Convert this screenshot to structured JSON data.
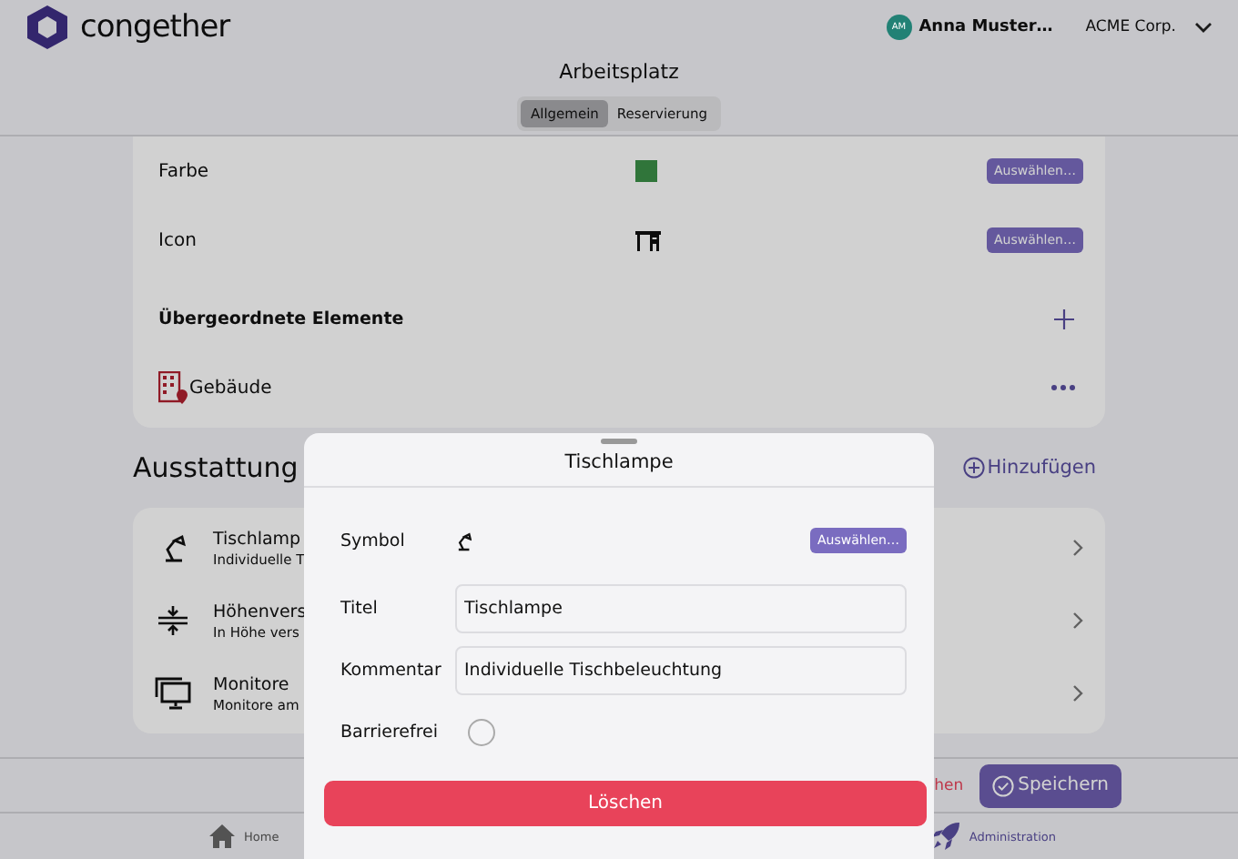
{
  "header": {
    "logo_text": "congether",
    "user": {
      "initials": "AM",
      "name": "Anna Muster…",
      "color": "#228175"
    },
    "organization": "ACME Corp."
  },
  "page": {
    "title": "Arbeitsplatz",
    "tabs": [
      {
        "label": "Allgemein",
        "selected": true
      },
      {
        "label": "Reservierung",
        "selected": false
      }
    ]
  },
  "properties": [
    {
      "kind": "color",
      "label": "Farbe",
      "color": "#30753a",
      "button": "Auswählen…"
    },
    {
      "kind": "icon",
      "label": "Icon",
      "button": "Auswählen…"
    }
  ],
  "parents": {
    "title": "Übergeordnete Elemente",
    "items": [
      {
        "label": "Gebäude"
      }
    ]
  },
  "equipment": {
    "title": "Ausstattung",
    "add_label": "Hinzufügen",
    "items": [
      {
        "kind": "lamp",
        "title": "Tischlamp",
        "subtitle": "Individuelle T"
      },
      {
        "kind": "height",
        "title": "Höhenvers",
        "subtitle": "In Höhe vers"
      },
      {
        "kind": "monitor",
        "title": "Monitore",
        "subtitle": "Monitore am"
      }
    ]
  },
  "footer": {
    "delete_label": "hen",
    "save_label": "Speichern"
  },
  "bottom_nav": [
    {
      "kind": "home",
      "label": "Home"
    },
    {
      "kind": "rocket",
      "label": "Administration"
    }
  ],
  "modal": {
    "title": "Tischlampe",
    "symbol_label": "Symbol",
    "symbol_button": "Auswählen…",
    "fields": [
      {
        "label": "Titel",
        "value": "Tischlampe"
      },
      {
        "label": "Kommentar",
        "value": "Individuelle Tischbeleuchtung"
      }
    ],
    "accessible": {
      "label": "Barrierefrei",
      "checked": false
    },
    "delete_button": "Löschen"
  }
}
